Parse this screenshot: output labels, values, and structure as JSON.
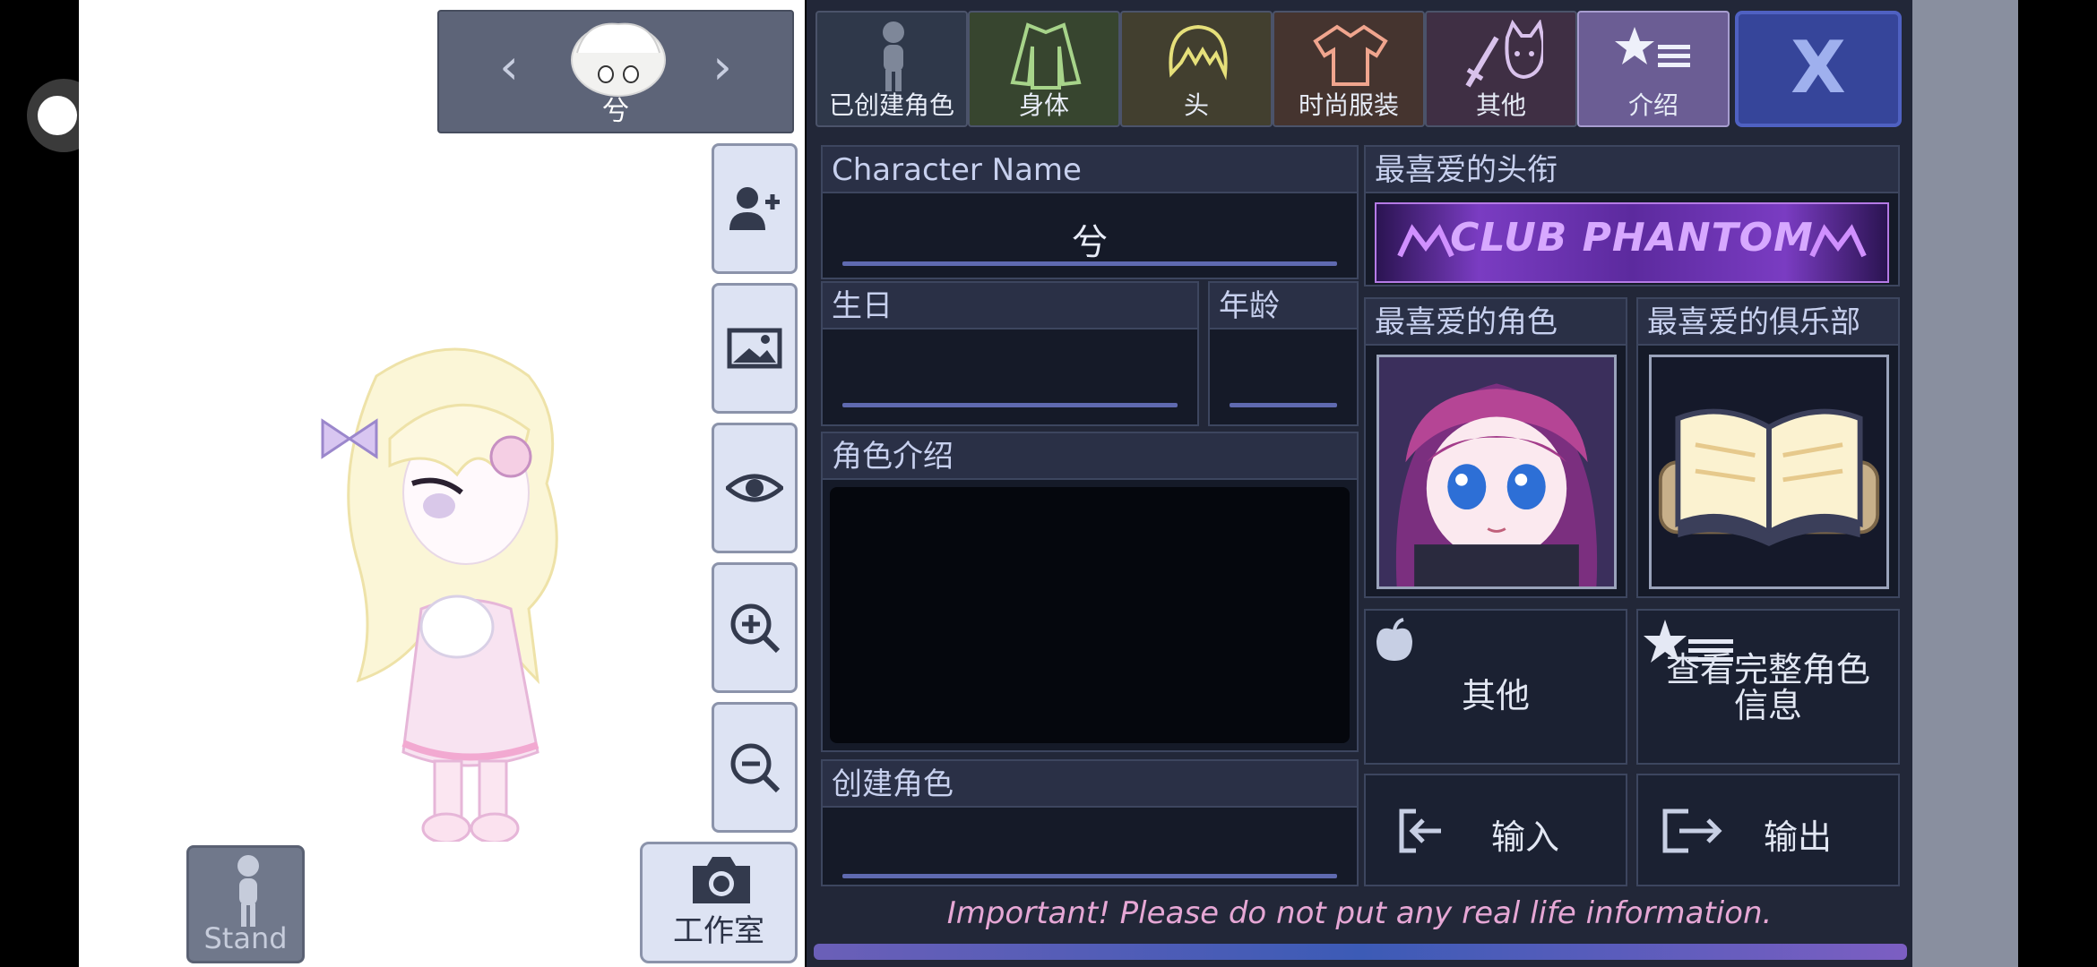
{
  "character_selector": {
    "name": "兮",
    "prev_glyph": "‹",
    "next_glyph": "›"
  },
  "tabs": [
    {
      "label": "已创建角色",
      "icon": "mannequin-icon",
      "bg": "#2f384a"
    },
    {
      "label": "身体",
      "icon": "jacket-icon",
      "bg": "#37452f"
    },
    {
      "label": "头",
      "icon": "hair-icon",
      "bg": "#423f2f"
    },
    {
      "label": "时尚服装",
      "icon": "shirt-icon",
      "bg": "#45342f"
    },
    {
      "label": "其他",
      "icon": "sword-cat-icon",
      "bg": "#3f2f44"
    },
    {
      "label": "介绍",
      "icon": "star-list-icon",
      "bg": "#6b5d94",
      "active": true
    }
  ],
  "close_label": "X",
  "profile": {
    "name_header": "Character Name",
    "name_value": "兮",
    "birthday_header": "生日",
    "age_header": "年龄",
    "bio_header": "角色介绍",
    "creator_header": "创建角色",
    "favorite_title_header": "最喜爱的头衔",
    "favorite_title_banner": "CLUB PHANTOM",
    "favorite_character_header": "最喜爱的角色",
    "favorite_club_header": "最喜爱的俱乐部"
  },
  "actions": {
    "other_label": "其他",
    "full_info_label": "查看完整角色信息",
    "import_label": "输入",
    "export_label": "输出"
  },
  "warning": "Important! Please do not put any real life information.",
  "stand_label": "Stand",
  "studio_label": "工作室",
  "tool_buttons": [
    "add-character-icon",
    "background-image-icon",
    "eye-icon",
    "zoom-in-icon",
    "zoom-out-icon"
  ]
}
